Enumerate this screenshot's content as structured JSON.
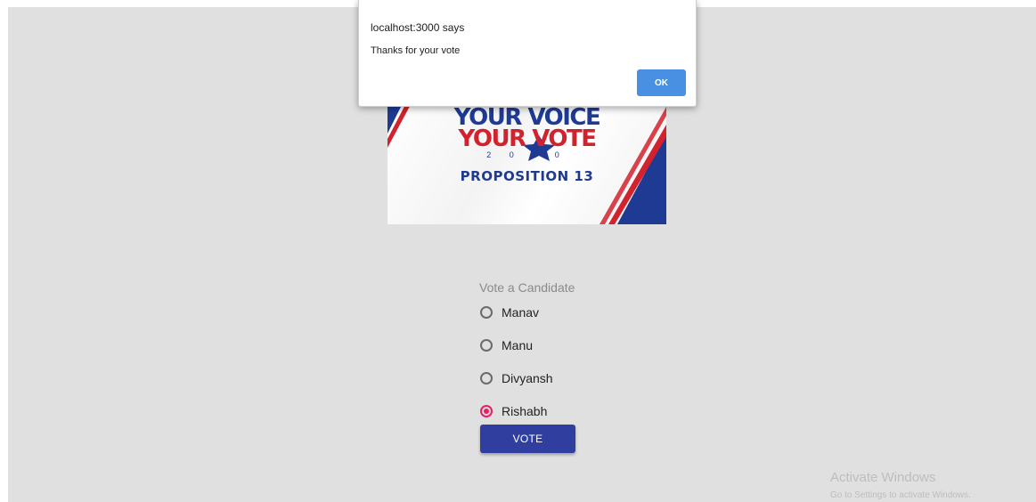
{
  "banner": {
    "line1": "YOUR VOICE",
    "line2": "YOUR VOTE",
    "year": "2 0 2 0",
    "proposition": "PROPOSITION 13"
  },
  "form": {
    "label": "Vote a Candidate",
    "options": [
      {
        "label": "Manav",
        "selected": false
      },
      {
        "label": "Manu",
        "selected": false
      },
      {
        "label": "Divyansh",
        "selected": false
      },
      {
        "label": "Rishabh",
        "selected": true
      }
    ],
    "vote_button": "VOTE",
    "accent_color": "#e91e63",
    "button_color": "#303f9f"
  },
  "dialog": {
    "origin": "localhost:3000 says",
    "message": "Thanks for your vote",
    "ok_label": "OK"
  },
  "watermark": {
    "title": "Activate Windows",
    "subtitle": "Go to Settings to activate Windows."
  }
}
